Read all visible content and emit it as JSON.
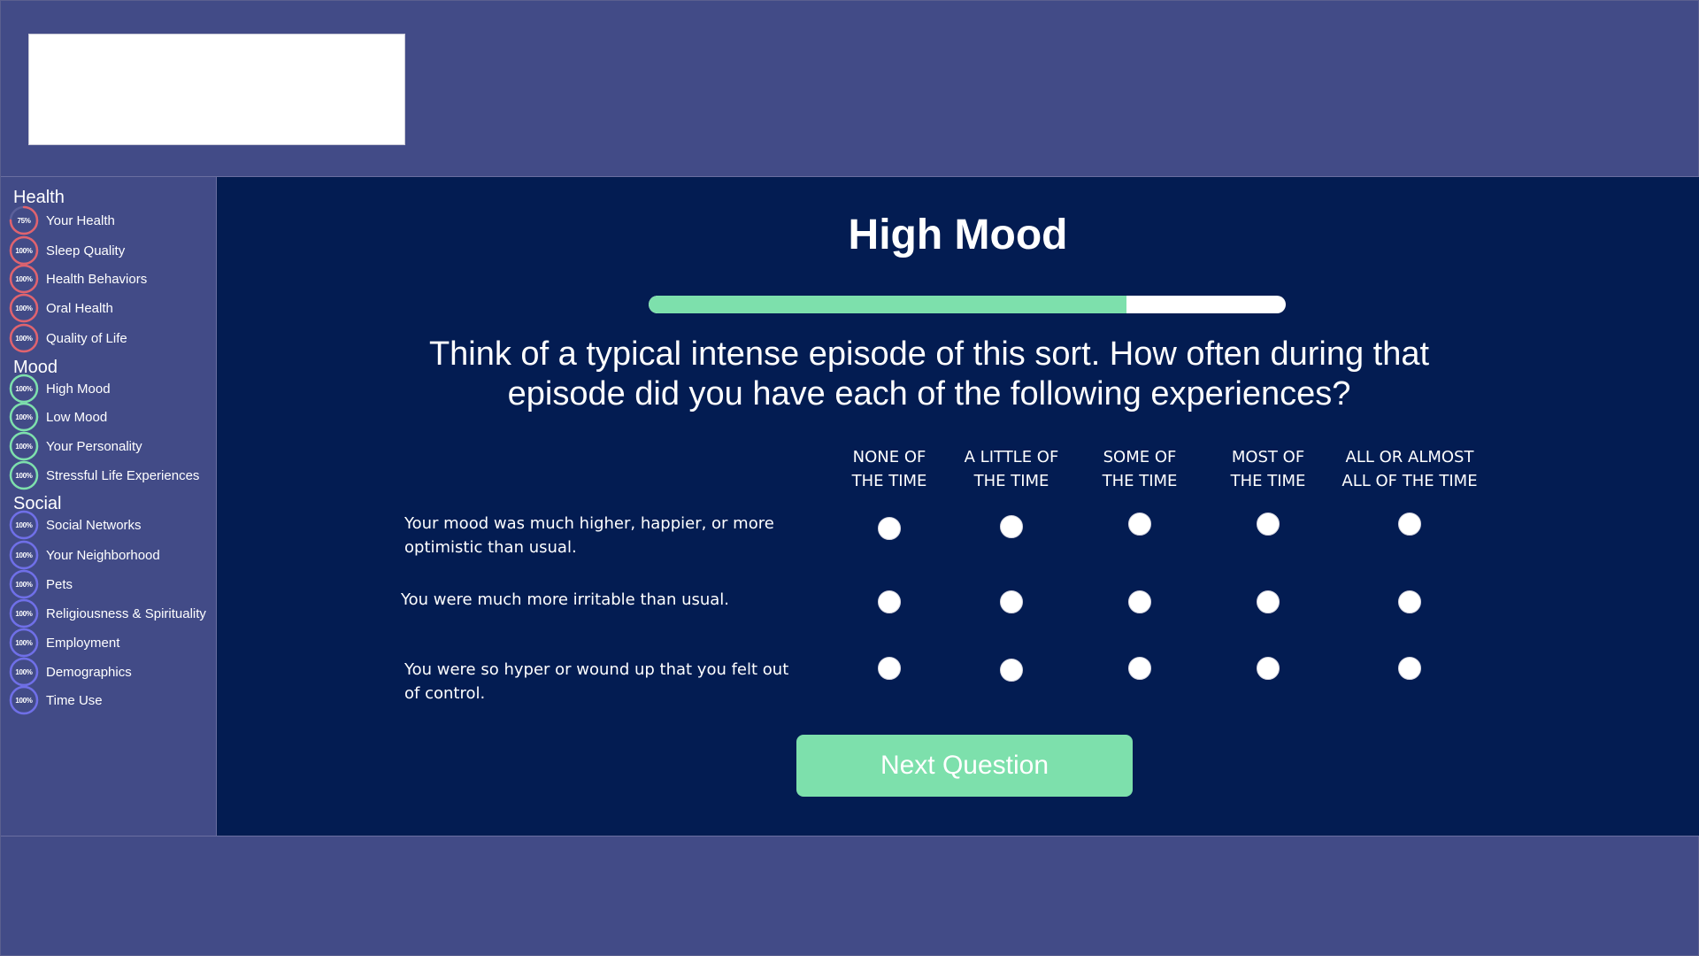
{
  "colors": {
    "background": "#424b87",
    "main_panel": "#031c52",
    "accent_green": "#7de0ac",
    "health_ring": "#e0636e",
    "mood_ring": "#7de0ac",
    "social_ring": "#6f6fe8"
  },
  "logo": {
    "text": ""
  },
  "sidebar": {
    "sections": [
      {
        "title": "Health",
        "ring_color": "#e0636e",
        "items": [
          {
            "label": "Your Health",
            "progress": 75,
            "progress_label": "75%"
          },
          {
            "label": "Sleep Quality",
            "progress": 100,
            "progress_label": "100%"
          },
          {
            "label": "Health Behaviors",
            "progress": 100,
            "progress_label": "100%"
          },
          {
            "label": "Oral Health",
            "progress": 100,
            "progress_label": "100%"
          },
          {
            "label": "Quality of Life",
            "progress": 100,
            "progress_label": "100%"
          }
        ]
      },
      {
        "title": "Mood",
        "ring_color": "#7de0ac",
        "items": [
          {
            "label": "High Mood",
            "progress": 100,
            "progress_label": "100%"
          },
          {
            "label": "Low Mood",
            "progress": 100,
            "progress_label": "100%"
          },
          {
            "label": "Your Personality",
            "progress": 100,
            "progress_label": "100%"
          },
          {
            "label": "Stressful Life Experiences",
            "progress": 100,
            "progress_label": "100%"
          }
        ]
      },
      {
        "title": "Social",
        "ring_color": "#6f6fe8",
        "items": [
          {
            "label": "Social Networks",
            "progress": 100,
            "progress_label": "100%"
          },
          {
            "label": "Your Neighborhood",
            "progress": 100,
            "progress_label": "100%"
          },
          {
            "label": "Pets",
            "progress": 100,
            "progress_label": "100%"
          },
          {
            "label": "Religiousness & Spirituality",
            "progress": 100,
            "progress_label": "100%"
          },
          {
            "label": "Employment",
            "progress": 100,
            "progress_label": "100%"
          },
          {
            "label": "Demographics",
            "progress": 100,
            "progress_label": "100%"
          },
          {
            "label": "Time Use",
            "progress": 100,
            "progress_label": "100%"
          }
        ]
      }
    ]
  },
  "main": {
    "title": "High Mood",
    "progress_fraction": 0.75,
    "question": "Think of a typical intense episode of this sort. How often during that episode did you have each of the following experiences?",
    "columns": [
      {
        "line1": "NONE OF",
        "line2": "THE TIME"
      },
      {
        "line1": "A LITTLE OF",
        "line2": "THE TIME"
      },
      {
        "line1": "SOME OF",
        "line2": "THE TIME"
      },
      {
        "line1": "MOST OF",
        "line2": "THE TIME"
      },
      {
        "line1": "ALL OR ALMOST",
        "line2": "ALL OF THE TIME"
      }
    ],
    "rows": [
      {
        "statement": "Your mood was much higher, happier, or more optimistic than usual."
      },
      {
        "statement": "You were much more irritable than usual."
      },
      {
        "statement": "You were so hyper or wound up that you felt out of control."
      }
    ],
    "next_button_label": "Next Question"
  }
}
